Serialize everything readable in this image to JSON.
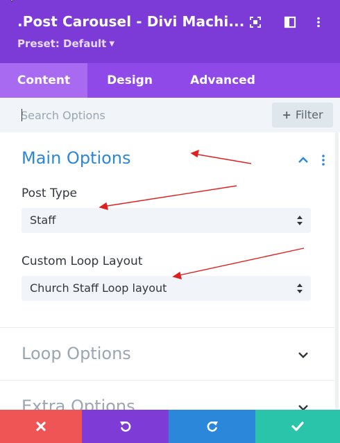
{
  "header": {
    "title": ".Post Carousel - Divi Machi...",
    "preset_label": "Preset: Default",
    "icons": [
      "screenshot-icon",
      "sidebar-layout-icon",
      "more-vertical-icon"
    ]
  },
  "tabs": [
    {
      "label": "Content",
      "active": true
    },
    {
      "label": "Design",
      "active": false
    },
    {
      "label": "Advanced",
      "active": false
    }
  ],
  "search": {
    "placeholder": "Search Options",
    "value": "",
    "filter_label": "Filter"
  },
  "main_options": {
    "title": "Main Options",
    "post_type": {
      "label": "Post Type",
      "value": "Staff"
    },
    "custom_loop_layout": {
      "label": "Custom Loop Layout",
      "value": "Church Staff Loop layout"
    }
  },
  "loop_options": {
    "title": "Loop Options"
  },
  "extra_options": {
    "title": "Extra Options"
  },
  "bottom_bar": {
    "buttons": [
      {
        "name": "discard",
        "icon": "close-icon",
        "color": "#ef5555"
      },
      {
        "name": "undo",
        "icon": "undo-icon",
        "color": "#7f3bd6"
      },
      {
        "name": "redo",
        "icon": "redo-icon",
        "color": "#2b87da"
      },
      {
        "name": "save",
        "icon": "check-icon",
        "color": "#29c4a9"
      }
    ]
  },
  "colors": {
    "header_bg": "#7c3bd6",
    "tabs_bg": "#8e49e8",
    "active_tab_bg": "#a76af1",
    "accent_blue": "#2b87da",
    "annotation_arrow": "#e02020"
  }
}
